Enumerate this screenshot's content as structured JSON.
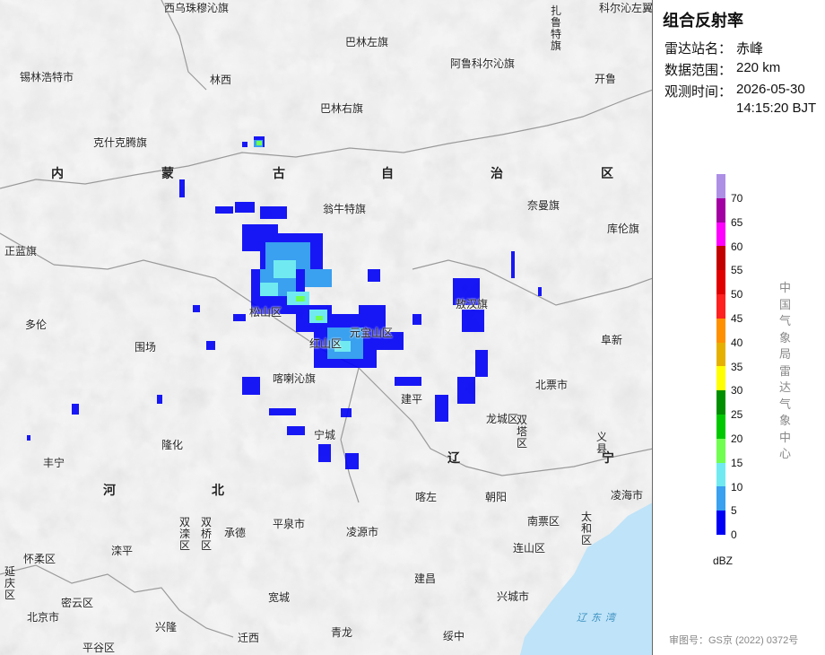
{
  "panel": {
    "title": "组合反射率",
    "rows": [
      {
        "label": "雷达站名：",
        "value": "赤峰"
      },
      {
        "label": "数据范围：",
        "value": "220 km"
      },
      {
        "label": "观测时间：",
        "value": "2026-05-30"
      },
      {
        "label": "",
        "value": "14:15:20 BJT"
      }
    ],
    "legend_unit": "dBZ",
    "legend": [
      {
        "value": "70",
        "color": "#ad8fe6"
      },
      {
        "value": "65",
        "color": "#a300a3"
      },
      {
        "value": "60",
        "color": "#ff00ff"
      },
      {
        "value": "55",
        "color": "#c20000"
      },
      {
        "value": "50",
        "color": "#e00000"
      },
      {
        "value": "45",
        "color": "#ff2020"
      },
      {
        "value": "40",
        "color": "#ff9000"
      },
      {
        "value": "35",
        "color": "#e6b000"
      },
      {
        "value": "30",
        "color": "#ffff00"
      },
      {
        "value": "25",
        "color": "#008f00"
      },
      {
        "value": "20",
        "color": "#00c800"
      },
      {
        "value": "15",
        "color": "#70ff50"
      },
      {
        "value": "10",
        "color": "#70eaf0"
      },
      {
        "value": "5",
        "color": "#3aa0f0"
      },
      {
        "value": "0",
        "color": "#0000f6"
      }
    ],
    "organization": "中国气象局雷达气象中心",
    "approval": "审图号：GS京 (2022) 0372号"
  },
  "map": {
    "place_labels": [
      "西乌珠穆沁旗",
      "巴林左旗",
      "阿鲁科尔沁旗",
      "扎鲁特旗",
      "科尔沁左翼中旗",
      "锡林浩特市",
      "林西",
      "开鲁",
      "巴林右旗",
      "克什克腾旗",
      "翁牛特旗",
      "奈曼旗",
      "库伦旗",
      "正蓝旗",
      "松山区",
      "敖汉旗",
      "多伦",
      "围场",
      "红山区",
      "元宝山区",
      "喀喇沁旗",
      "建平",
      "北票市",
      "阜新",
      "隆化",
      "宁城",
      "龙城区",
      "双塔区",
      "义县",
      "丰宁",
      "喀左",
      "朝阳",
      "凌海市",
      "双滦区",
      "双桥区",
      "承德",
      "平泉市",
      "凌源市",
      "南票区",
      "太和区",
      "怀柔区",
      "滦平",
      "连山区",
      "延庆区",
      "密云区",
      "兴隆",
      "宽城",
      "建昌",
      "兴城市",
      "北京市",
      "平谷区",
      "迁西",
      "青龙",
      "绥中"
    ],
    "region_labels": [
      "内",
      "蒙",
      "古",
      "自",
      "治",
      "区",
      "河",
      "北",
      "辽",
      "宁"
    ],
    "sea_label": "辽东湾"
  }
}
